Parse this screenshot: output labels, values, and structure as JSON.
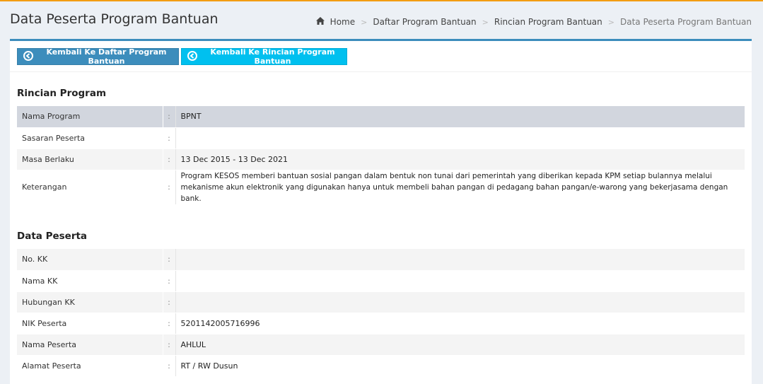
{
  "header": {
    "title": "Data Peserta Program Bantuan",
    "breadcrumb": [
      "Home",
      "Daftar Program Bantuan",
      "Rincian Program Bantuan",
      "Data Peserta Program Bantuan"
    ]
  },
  "toolbar": {
    "back_list_label": "Kembali Ke Daftar Program Bantuan",
    "back_detail_label": "Kembali Ke Rincian Program Bantuan"
  },
  "program": {
    "title": "Rincian Program",
    "rows": [
      {
        "label": "Nama Program",
        "colon": ":",
        "value": "BPNT"
      },
      {
        "label": "Sasaran Peserta",
        "colon": ":",
        "value": ""
      },
      {
        "label": "Masa Berlaku",
        "colon": ":",
        "value": "13 Dec 2015 - 13 Dec 2021"
      },
      {
        "label": "Keterangan",
        "colon": ":",
        "value": "Program KESOS memberi bantuan sosial pangan dalam bentuk non tunai dari pemerintah yang diberikan kepada KPM setiap bulannya melalui mekanisme akun elektronik yang digunakan hanya untuk membeli bahan pangan di pedagang bahan pangan/e-warong yang bekerjasama dengan bank."
      }
    ]
  },
  "peserta": {
    "title": "Data Peserta",
    "rows": [
      {
        "label": "No. KK",
        "colon": ":",
        "value": ""
      },
      {
        "label": "Nama KK",
        "colon": ":",
        "value": ""
      },
      {
        "label": "Hubungan KK",
        "colon": ":",
        "value": ""
      },
      {
        "label": "NIK Peserta",
        "colon": ":",
        "value": "5201142005716996"
      },
      {
        "label": "Nama Peserta",
        "colon": ":",
        "value": "AHLUL"
      },
      {
        "label": "Alamat Peserta",
        "colon": ":",
        "value": "RT / RW Dusun"
      }
    ]
  },
  "colors": {
    "primary": "#3c8dbc",
    "info": "#00c0ef",
    "accent_top": "#f39c12"
  }
}
